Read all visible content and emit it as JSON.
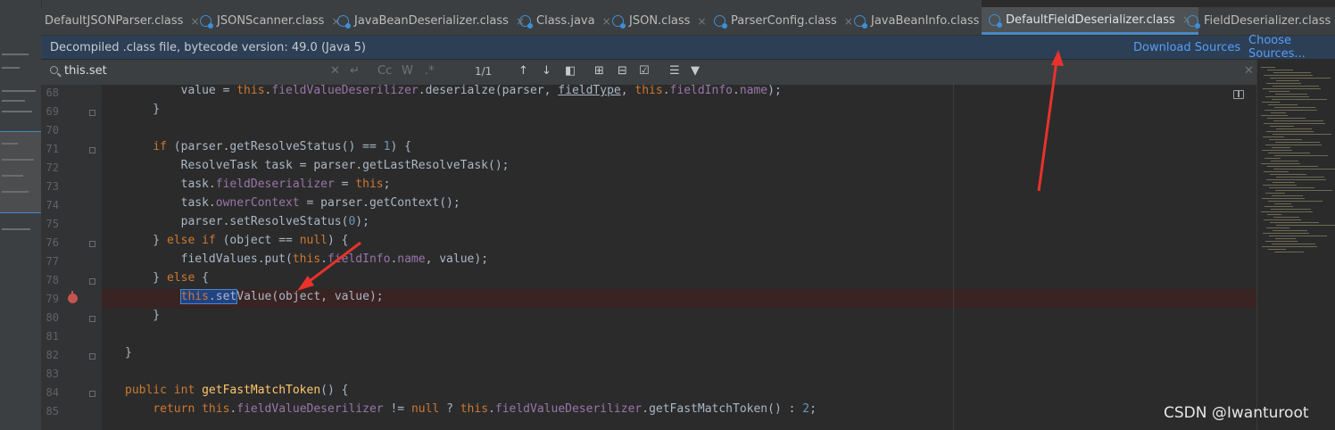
{
  "tabs": [
    {
      "label": "DefaultJSONParser.class",
      "active": false
    },
    {
      "label": "JSONScanner.class",
      "active": false
    },
    {
      "label": "JavaBeanDeserializer.class",
      "active": false
    },
    {
      "label": "Class.java",
      "active": false
    },
    {
      "label": "JSON.class",
      "active": false
    },
    {
      "label": "ParserConfig.class",
      "active": false
    },
    {
      "label": "JavaBeanInfo.class",
      "active": false
    },
    {
      "label": "DefaultFieldDeserializer.class",
      "active": true
    },
    {
      "label": "FieldDeserializer.class",
      "active": false
    }
  ],
  "tab_close_glyph": "×",
  "banner": {
    "message": "Decompiled .class file, bytecode version: 49.0 (Java 5)",
    "download_sources": "Download Sources",
    "choose_sources": "Choose Sources..."
  },
  "search": {
    "value": "this.set",
    "match_count": "1/1",
    "match_case": "Cc",
    "words": "W",
    "regex": ".*"
  },
  "editor": {
    "lines": [
      {
        "n": "68",
        "text": "        value = this.fieldValueDeserilizer.deserialze(parser, fieldType, this.fieldInfo.name);"
      },
      {
        "n": "69",
        "text": "    }"
      },
      {
        "n": "70",
        "text": ""
      },
      {
        "n": "71",
        "text": "    if (parser.getResolveStatus() == 1) {"
      },
      {
        "n": "72",
        "text": "        ResolveTask task = parser.getLastResolveTask();"
      },
      {
        "n": "73",
        "text": "        task.fieldDeserializer = this;"
      },
      {
        "n": "74",
        "text": "        task.ownerContext = parser.getContext();"
      },
      {
        "n": "75",
        "text": "        parser.setResolveStatus(0);"
      },
      {
        "n": "76",
        "text": "    } else if (object == null) {"
      },
      {
        "n": "77",
        "text": "        fieldValues.put(this.fieldInfo.name, value);"
      },
      {
        "n": "78",
        "text": "    } else {"
      },
      {
        "n": "79",
        "text": "        this.setValue(object, value);"
      },
      {
        "n": "80",
        "text": "    }"
      },
      {
        "n": "81",
        "text": ""
      },
      {
        "n": "82",
        "text": "}"
      },
      {
        "n": "83",
        "text": ""
      },
      {
        "n": "84",
        "text": "public int getFastMatchToken() {"
      },
      {
        "n": "85",
        "text": "    return this.fieldValueDeserilizer != null ? this.fieldValueDeserilizer.getFastMatchToken() : 2;"
      }
    ],
    "breakpoint_line": "79"
  },
  "watermark": "CSDN @Iwanturoot",
  "colors": {
    "keyword": "#cc7832",
    "field": "#9876aa",
    "number": "#6897bb",
    "method_decl": "#ffc66d",
    "plain": "#a9b7c6",
    "accent": "#4a88c7",
    "breakpoint": "#c75450",
    "annotation_arrow": "#e8322b"
  }
}
